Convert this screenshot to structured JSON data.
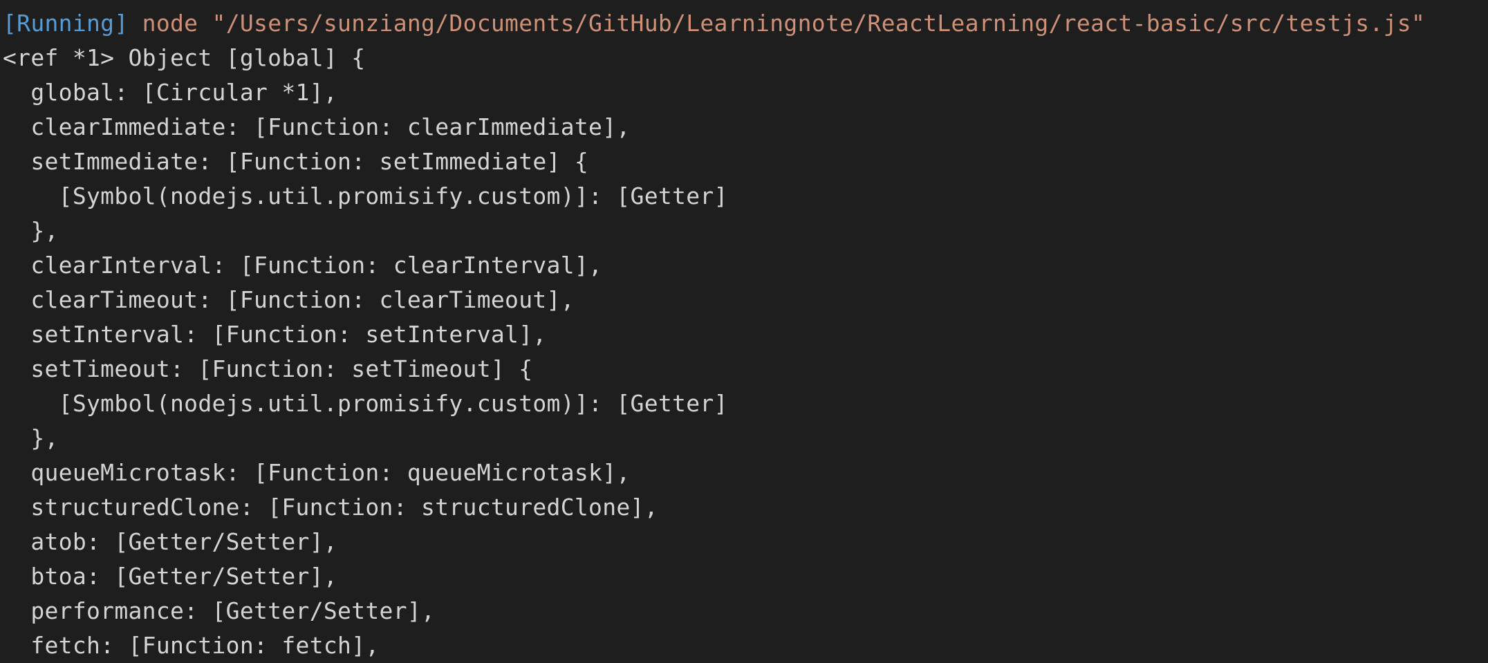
{
  "output": {
    "running_tag": "[Running]",
    "command": " node \"/Users/sunziang/Documents/GitHub/Learningnote/ReactLearning/react-basic/src/testjs.js\"",
    "lines": [
      "<ref *1> Object [global] {",
      "  global: [Circular *1],",
      "  clearImmediate: [Function: clearImmediate],",
      "  setImmediate: [Function: setImmediate] {",
      "    [Symbol(nodejs.util.promisify.custom)]: [Getter]",
      "  },",
      "  clearInterval: [Function: clearInterval],",
      "  clearTimeout: [Function: clearTimeout],",
      "  setInterval: [Function: setInterval],",
      "  setTimeout: [Function: setTimeout] {",
      "    [Symbol(nodejs.util.promisify.custom)]: [Getter]",
      "  },",
      "  queueMicrotask: [Function: queueMicrotask],",
      "  structuredClone: [Function: structuredClone],",
      "  atob: [Getter/Setter],",
      "  btoa: [Getter/Setter],",
      "  performance: [Getter/Setter],",
      "  fetch: [Function: fetch],"
    ]
  },
  "colors": {
    "background": "#1e1e1e",
    "running_tag": "#569cd6",
    "command": "#ce9178",
    "text": "#d4d4d4"
  }
}
